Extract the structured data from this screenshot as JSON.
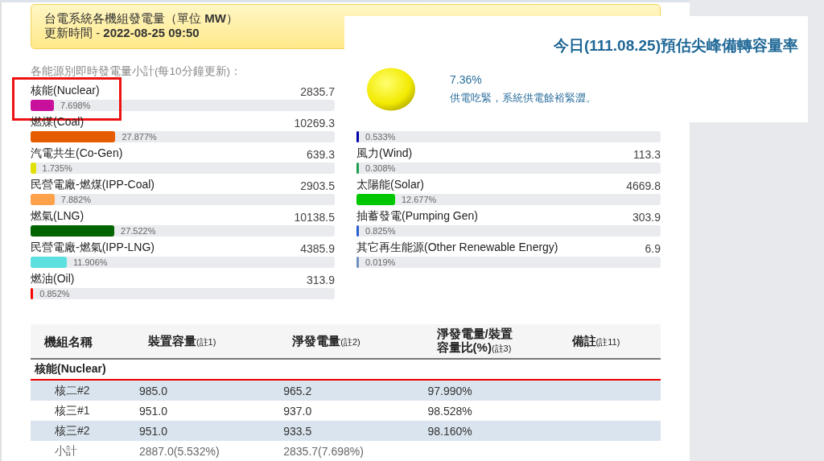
{
  "banner": {
    "title": "台電系統各機組發電量（單位 **MW**）",
    "updated": "更新時間 - **2022-08-25 09:50**"
  },
  "subtitle": "各能源別即時發電量小計(每10分鐘更新)：",
  "left_sources": [
    {
      "label": "核能(Nuclear)",
      "value": "2835.7",
      "percent": "7.698%",
      "level": 0.07698,
      "color": "#c8109a",
      "highlighted": true
    },
    {
      "label": "燃煤(Coal)",
      "value": "10269.3",
      "percent": "27.877%",
      "level": 0.27877,
      "color": "#e65c00",
      "highlighted": false
    },
    {
      "label": "汽電共生(Co-Gen)",
      "value": "639.3",
      "percent": "1.735%",
      "level": 0.01735,
      "color": "#e2e000",
      "highlighted": false
    },
    {
      "label": "民營電廠-燃煤(IPP-Coal)",
      "value": "2903.5",
      "percent": "7.882%",
      "level": 0.07882,
      "color": "#ffa04a",
      "highlighted": false
    },
    {
      "label": "燃氣(LNG)",
      "value": "10138.5",
      "percent": "27.522%",
      "level": 0.27522,
      "color": "#006400",
      "highlighted": false
    },
    {
      "label": "民營電廠-燃氣(IPP-LNG)",
      "value": "4385.9",
      "percent": "11.906%",
      "level": 0.11906,
      "color": "#5ce0e0",
      "highlighted": false
    },
    {
      "label": "燃油(Oil)",
      "value": "313.9",
      "percent": "0.852%",
      "level": 0.00852,
      "color": "#ff0000",
      "highlighted": false
    }
  ],
  "right_sources": [
    {
      "percent": "0.533%",
      "level": 0.00533,
      "color": "#0000aa",
      "highlighted": false
    },
    {
      "label": "風力(Wind)",
      "value": "113.3",
      "percent": "0.308%",
      "level": 0.00308,
      "color": "#1fa050",
      "highlighted": false
    },
    {
      "label": "太陽能(Solar)",
      "value": "4669.8",
      "percent": "12.677%",
      "level": 0.12677,
      "color": "#00c800",
      "highlighted": false
    },
    {
      "label": "抽蓄發電(Pumping Gen)",
      "value": "303.9",
      "percent": "0.825%",
      "level": 0.00825,
      "color": "#2a5fd0",
      "highlighted": false
    },
    {
      "label": "其它再生能源(Other Renewable Energy)",
      "value": "6.9",
      "percent": "0.019%",
      "level": 0.00019,
      "color": "#7090c0",
      "highlighted": false
    }
  ],
  "popup": {
    "title": "今日(111.08.25)預估尖峰備轉容量率",
    "rate": "7.36%",
    "message": "供電吃緊，系統供電餘裕緊澀。",
    "color": "#f2ea00"
  },
  "table": {
    "columns": [
      {
        "label": "機組名稱"
      },
      {
        "label": "裝置容量",
        "note": "(註1)"
      },
      {
        "label": "淨發電量",
        "note": "(註2)"
      },
      {
        "label": "淨發電量/裝置容量比(%)",
        "note": "(註3)"
      },
      {
        "label": "備註",
        "note": "(註11)"
      }
    ],
    "group": "核能(Nuclear)",
    "rows": [
      {
        "kind": "unit",
        "cells": [
          "核二#2",
          "985.0",
          "965.2",
          "97.990%"
        ]
      },
      {
        "kind": "unit",
        "cells": [
          "核三#1",
          "951.0",
          "937.0",
          "98.528%"
        ]
      },
      {
        "kind": "unit",
        "cells": [
          "核三#2",
          "951.0",
          "933.5",
          "98.160%"
        ]
      },
      {
        "kind": "subtotal",
        "cells": [
          "小計",
          "2887.0(5.532%)",
          "2835.7(7.698%)"
        ]
      }
    ]
  }
}
